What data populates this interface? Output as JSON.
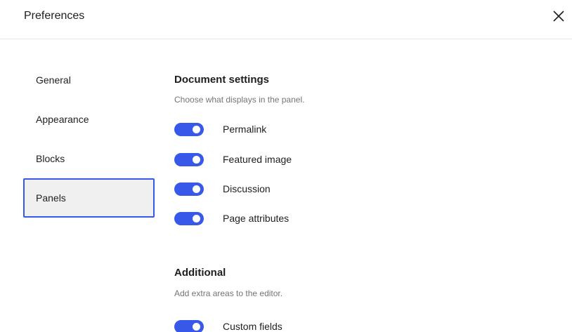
{
  "window": {
    "title": "Preferences"
  },
  "icons": {
    "close": "close-icon"
  },
  "colors": {
    "accent": "#3858e9",
    "active_nav_bg": "#f0f0f0",
    "muted_text": "#757575",
    "text": "#1e1e1e"
  },
  "nav": {
    "items": [
      {
        "label": "General"
      },
      {
        "label": "Appearance"
      },
      {
        "label": "Blocks"
      },
      {
        "label": "Panels"
      }
    ],
    "active": "Panels"
  },
  "document_settings": {
    "title": "Document settings",
    "description": "Choose what displays in the panel.",
    "toggles": [
      {
        "label": "Permalink",
        "enabled": true
      },
      {
        "label": "Featured image",
        "enabled": true
      },
      {
        "label": "Discussion",
        "enabled": true
      },
      {
        "label": "Page attributes",
        "enabled": true
      }
    ]
  },
  "additional": {
    "title": "Additional",
    "description": "Add extra areas to the editor.",
    "toggles": [
      {
        "label": "Custom fields",
        "enabled": true
      }
    ]
  }
}
